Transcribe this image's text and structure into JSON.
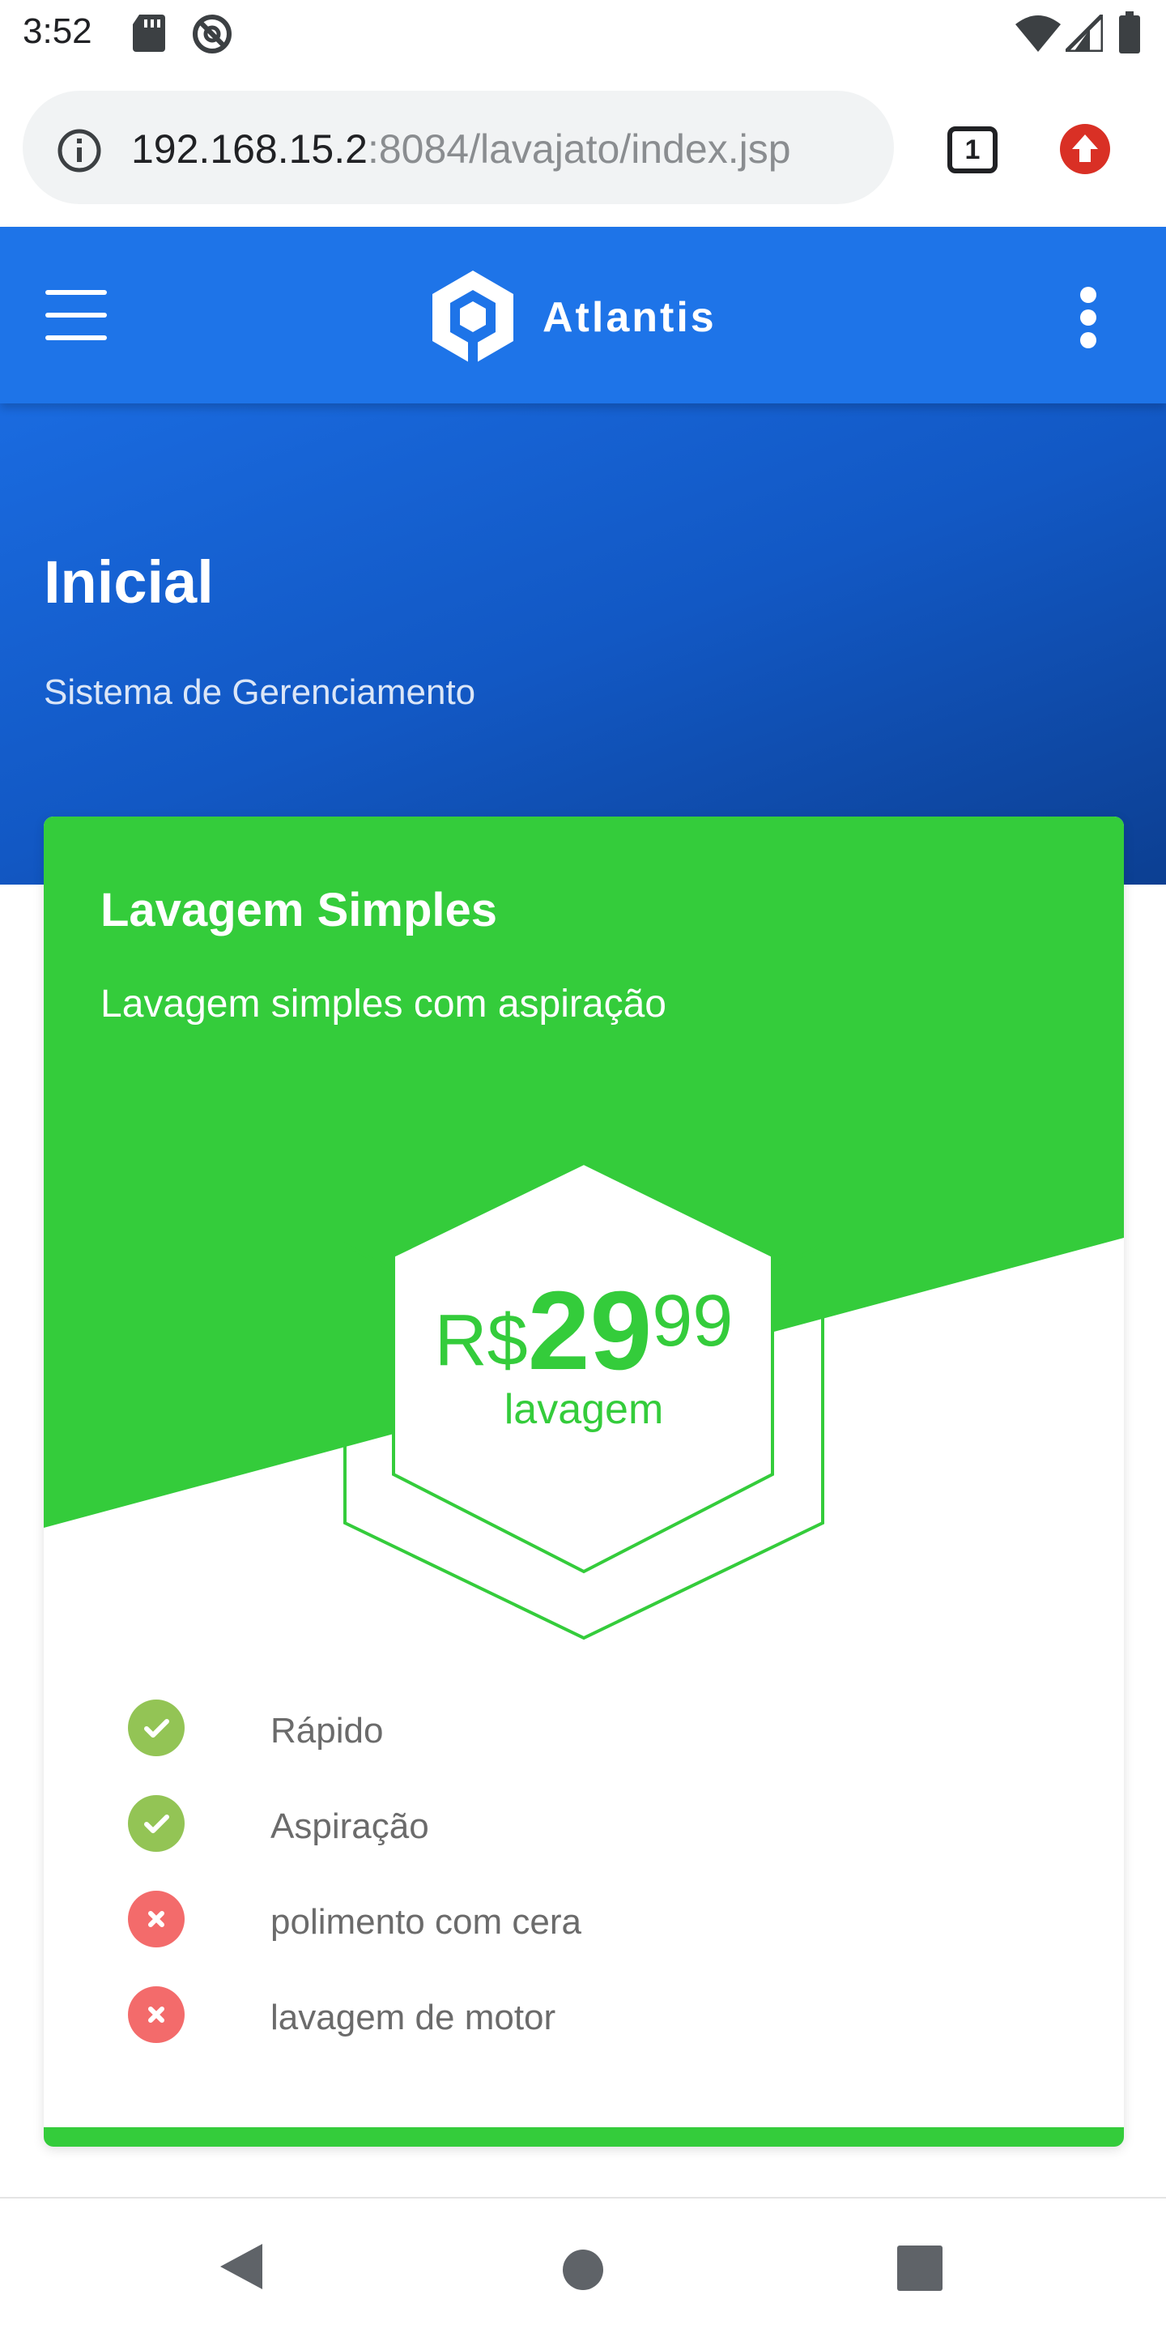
{
  "status_bar": {
    "time": "3:52",
    "icons": [
      "sd-card-icon",
      "do-not-disturb-icon",
      "wifi-icon",
      "signal-icon",
      "battery-icon"
    ]
  },
  "browser": {
    "url_host": "192.168.15.2",
    "url_path": ":8084/lavajato/index.jsp",
    "tab_count": "1",
    "icons": [
      "info-icon",
      "tab-switcher-icon",
      "update-icon"
    ]
  },
  "app_header": {
    "brand": "Atlantis",
    "icons": [
      "menu-icon",
      "logo-icon",
      "more-vert-icon"
    ],
    "brand_color": "#1e74e8"
  },
  "hero": {
    "title": "Inicial",
    "subtitle": "Sistema de Gerenciamento"
  },
  "card": {
    "title": "Lavagem Simples",
    "subtitle": "Lavagem simples com aspiração",
    "accent_color": "#34cc3b",
    "price": {
      "currency": "R$",
      "integer": "29",
      "cents": "99",
      "unit": "lavagem"
    },
    "features": [
      {
        "label": "Rápido",
        "included": true
      },
      {
        "label": "Aspiração",
        "included": true
      },
      {
        "label": "polimento com cera",
        "included": false
      },
      {
        "label": "lavagem de motor",
        "included": false
      }
    ]
  },
  "nav_bar": {
    "icons": [
      "back-icon",
      "home-icon",
      "recents-icon"
    ]
  }
}
